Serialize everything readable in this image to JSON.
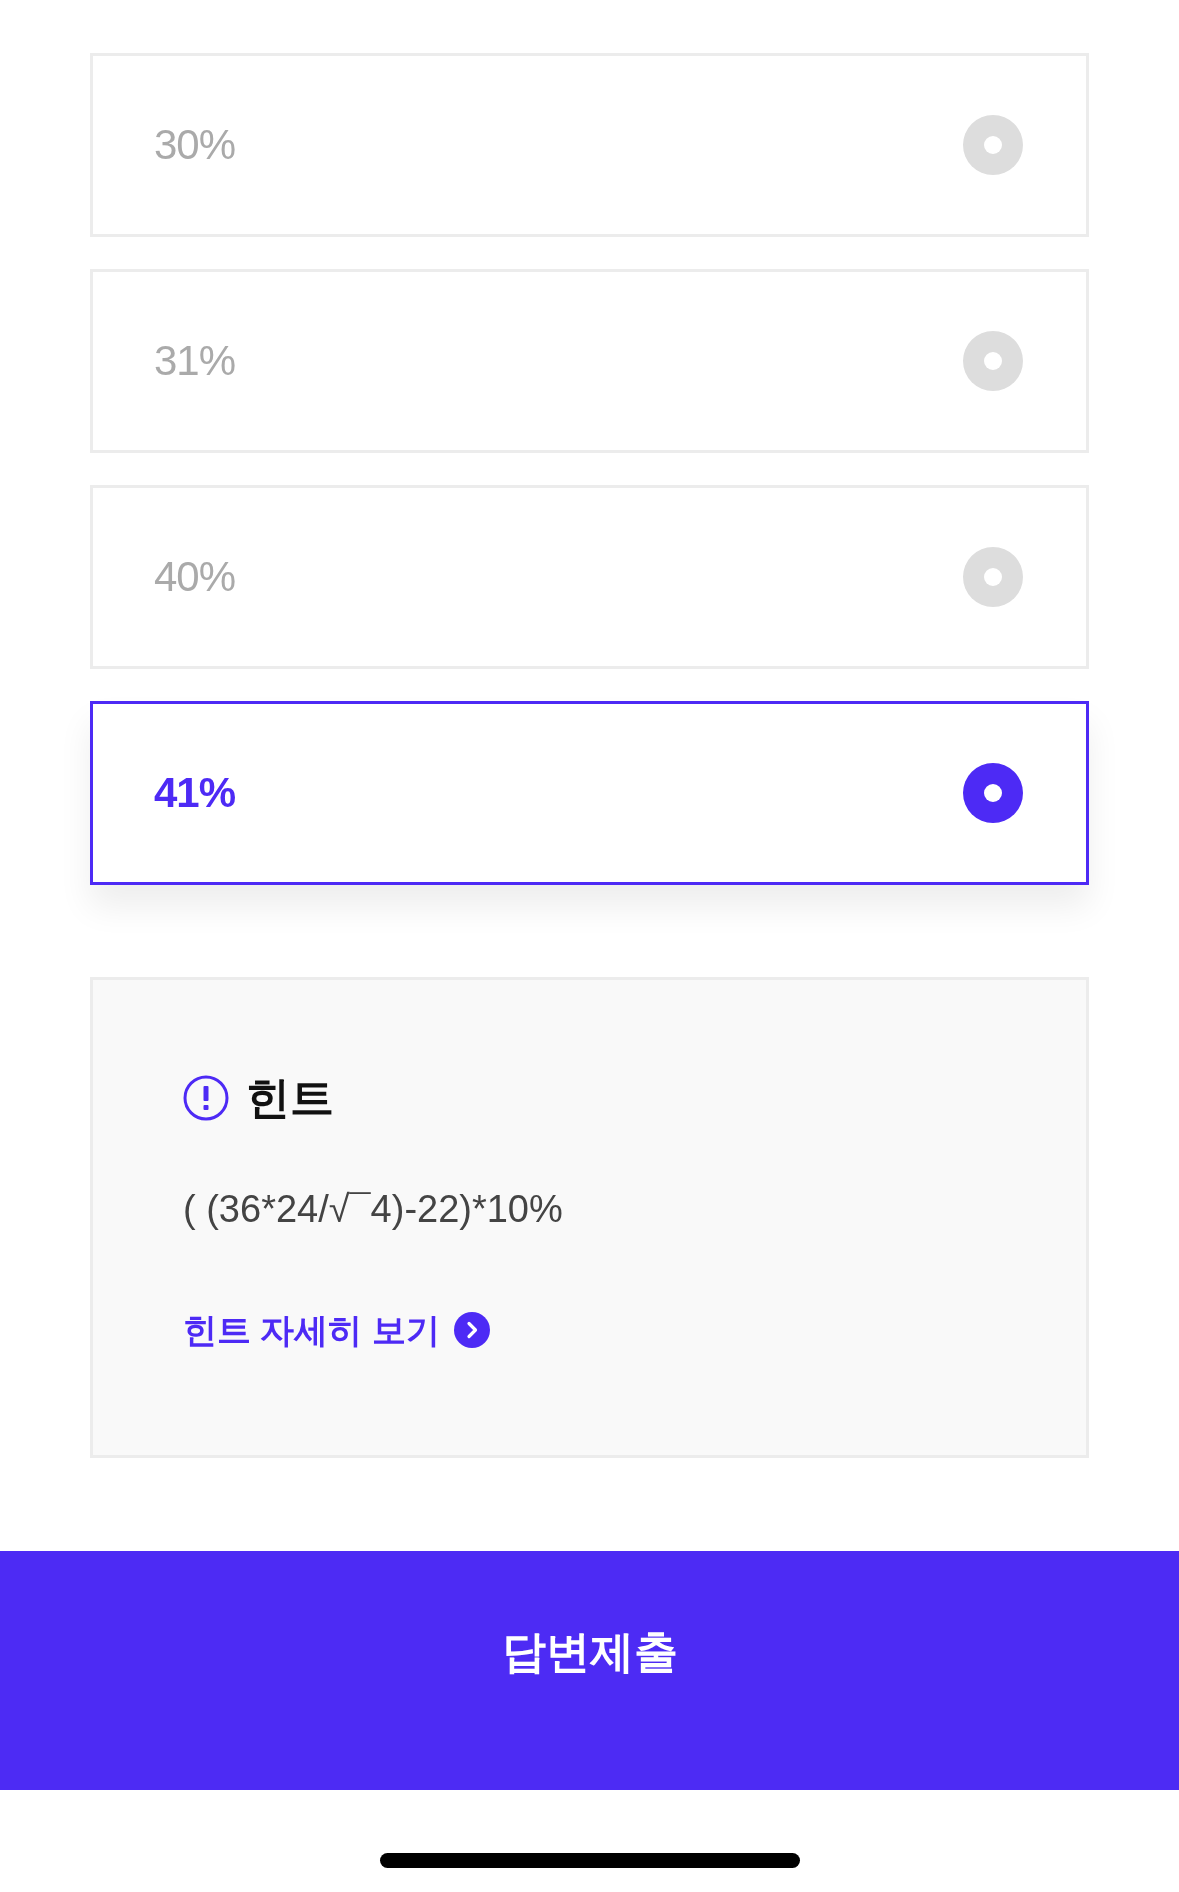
{
  "options": [
    {
      "label": "30%",
      "selected": false
    },
    {
      "label": "31%",
      "selected": false
    },
    {
      "label": "40%",
      "selected": false
    },
    {
      "label": "41%",
      "selected": true
    }
  ],
  "hint": {
    "title": "힌트",
    "formula": "( (36*24/√¯4)-22)*10%",
    "link": "힌트 자세히 보기"
  },
  "submit_button": {
    "label": "답변제출"
  }
}
